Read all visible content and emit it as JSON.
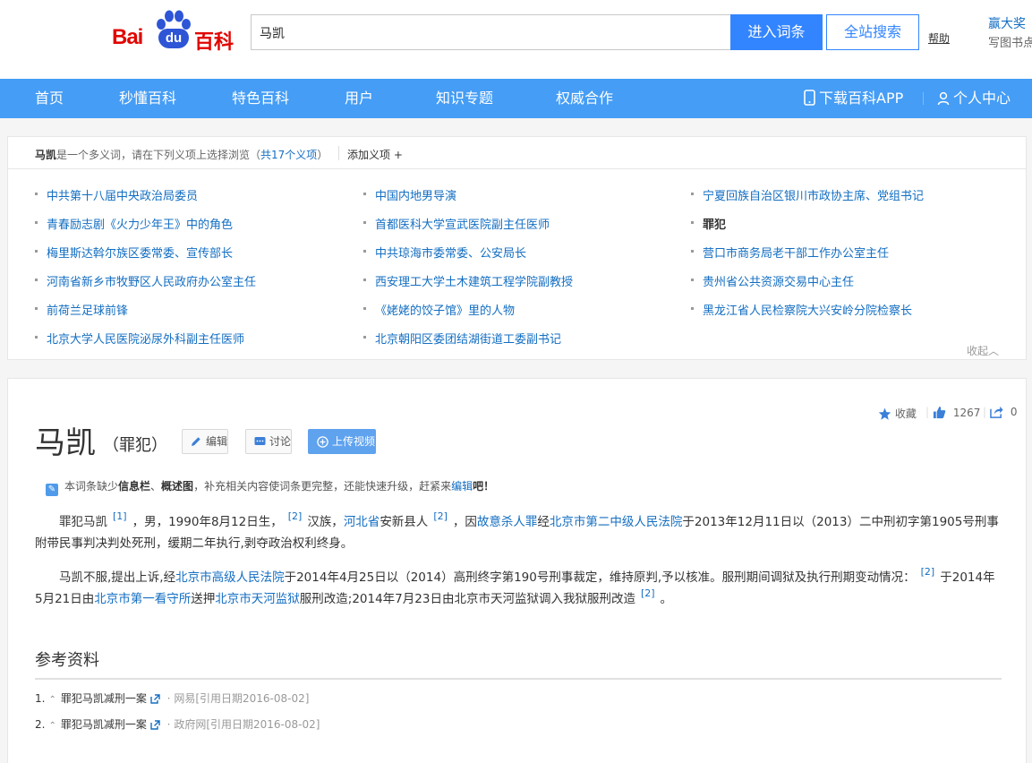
{
  "header": {
    "logo": {
      "bai": "Bai",
      "du": "du",
      "baike": "百科"
    },
    "search_value": "马凯",
    "enter_label": "进入词条",
    "search_all_label": "全站搜索",
    "help_label": "帮助",
    "promo_line1": "赢大奖",
    "promo_line2": "写图书点"
  },
  "nav": {
    "items": [
      "首页",
      "秒懂百科",
      "特色百科",
      "用户",
      "知识专题",
      "权威合作"
    ],
    "download_app": "下载百科APP",
    "user_center": "个人中心"
  },
  "polysemy": {
    "term": "马凯",
    "intro": "是一个多义词，请在下列义项上选择浏览（",
    "count": "共17个义项",
    "intro_end": "）",
    "add_label": "添加义项",
    "senses": [
      [
        "中共第十八届中央政治局委员",
        "中国内地男导演",
        "宁夏回族自治区银川市政协主席、党组书记"
      ],
      [
        "青春励志剧《火力少年王》中的角色",
        "首都医科大学宣武医院副主任医师",
        "罪犯"
      ],
      [
        "梅里斯达斡尔族区委常委、宣传部长",
        "中共琼海市委常委、公安局长",
        "营口市商务局老干部工作办公室主任"
      ],
      [
        "河南省新乡市牧野区人民政府办公室主任",
        "西安理工大学土木建筑工程学院副教授",
        "贵州省公共资源交易中心主任"
      ],
      [
        "前荷兰足球前锋",
        "《姥姥的饺子馆》里的人物",
        "黑龙江省人民检察院大兴安岭分院检察长"
      ],
      [
        "北京大学人民医院泌尿外科副主任医师",
        "北京朝阳区委团结湖街道工委副书记",
        ""
      ]
    ],
    "collapse_label": "收起"
  },
  "article": {
    "collect_label": "收藏",
    "like_count": "1267",
    "share_count": "0",
    "title": "马凯",
    "subtitle": "（罪犯）",
    "edit_label": "编辑",
    "discuss_label": "讨论",
    "upload_video_label": "上传视频",
    "tip": {
      "a": "本词条缺少",
      "b": "信息栏",
      "c": "、",
      "d": "概述图",
      "e": "，补充相关内容使词条更完整，还能快速升级，赶紧来",
      "f": "编辑",
      "g": "吧！"
    },
    "p1": {
      "a": "罪犯马凯",
      "s1": "[1]",
      "b": "，男，1990年8月12日生，",
      "s2": "[2]",
      "c": "汉族，",
      "l1": "河北省",
      "d": "安新县人",
      "s3": "[2]",
      "e": "，因",
      "l2": "故意杀人罪",
      "f": "经",
      "l3": "北京市第二中级人民法院",
      "g": "于2013年12月11日以（2013）二中刑初字第1905号刑事附带民事判决判处死刑，缓期二年执行,剥夺政治权利终身。"
    },
    "p2": {
      "a": "马凯不服,提出上诉,经",
      "l1": "北京市高级人民法院",
      "b": "于2014年4月25日以（2014）高刑终字第190号刑事裁定，维持原判,予以核准。服刑期间调狱及执行刑期变动情况：",
      "s1": "[2]",
      "c": "于2014年5月21日由",
      "l2": "北京市第一看守所",
      "d": "送押",
      "l3": "北京市天河监狱",
      "e": "服刑改造;2014年7月23日由北京市天河监狱调入我狱服刑改造",
      "s2": "[2]",
      "f": "。"
    },
    "references_title": "参考资料",
    "references": [
      {
        "num": "1.",
        "title": "罪犯马凯减刑一案",
        "source": "网易[引用日期2016-08-02]"
      },
      {
        "num": "2.",
        "title": "罪犯马凯减刑一案",
        "source": "政府网[引用日期2016-08-02]"
      }
    ]
  },
  "colors": {
    "nav_bg": "#459df5",
    "link": "#136ec2",
    "brand_red": "#e10602",
    "brand_blue": "#2d55d6",
    "button_blue": "#3385ff"
  }
}
